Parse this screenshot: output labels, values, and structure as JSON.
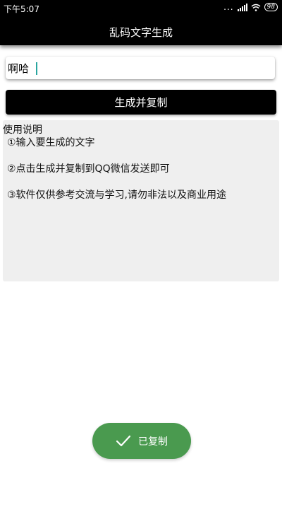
{
  "status_bar": {
    "time": "下午5:07",
    "dots": "...",
    "battery": "98"
  },
  "app_bar": {
    "title": "乱码文字生成"
  },
  "input": {
    "value": "啊哈"
  },
  "generate_button": {
    "label": "生成并复制"
  },
  "instructions": {
    "heading": "使用说明",
    "lines": [
      "①输入要生成的文字",
      "②点击生成并复制到QQ微信发送即可",
      "③软件仅供参考交流与学习,请勿非法以及商业用途"
    ]
  },
  "toast": {
    "icon": "check-icon",
    "text": "已复制",
    "color": "#4a9a4f"
  }
}
